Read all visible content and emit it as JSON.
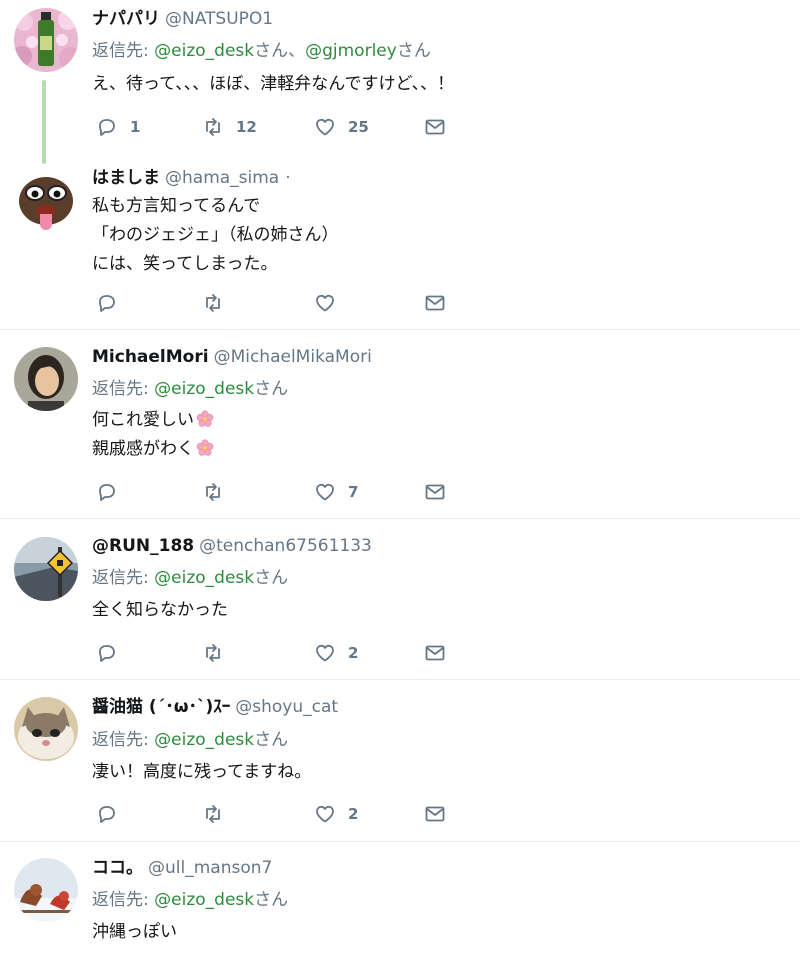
{
  "tweets": [
    {
      "name": "ナパパリ",
      "handle": "@NATSUPO1",
      "reply_prefix": "返信先: ",
      "mentions": [
        "@eizo_desk",
        "@gjmorley"
      ],
      "mention_suffix": "さん",
      "mention_sep": "、",
      "lines": [
        "え、待って、、、ほぼ、津軽弁なんですけど、、！"
      ],
      "replies": "1",
      "retweets": "12",
      "likes": "25",
      "avatar_icon": "green-bottle-on-flowers-avatar"
    },
    {
      "name": "はましま",
      "handle": "@hama_sima",
      "dot": "·",
      "lines": [
        "私も方言知ってるんで",
        "「わのジェジェ」（私の姉さん）",
        "には、笑ってしまった。"
      ],
      "replies": "",
      "retweets": "",
      "likes": "",
      "avatar_icon": "cartoon-face-avatar"
    },
    {
      "name": "MichaelMori",
      "handle": "@MichaelMikaMori",
      "reply_prefix": "返信先: ",
      "mentions": [
        "@eizo_desk"
      ],
      "mention_suffix": "さん",
      "lines": [
        "何これ愛しい",
        "親戚感がわく"
      ],
      "line_emoji": [
        "cherry-blossom",
        "cherry-blossom"
      ],
      "replies": "",
      "retweets": "",
      "likes": "7",
      "avatar_icon": "woman-portrait-avatar"
    },
    {
      "name": "@RUN_188",
      "handle": "@tenchan67561133",
      "reply_prefix": "返信先: ",
      "mentions": [
        "@eizo_desk"
      ],
      "mention_suffix": "さん",
      "lines": [
        "全く知らなかった"
      ],
      "replies": "",
      "retweets": "",
      "likes": "2",
      "avatar_icon": "road-sign-avatar"
    },
    {
      "name": "醤油猫 (´･ω･`)ｽｰ",
      "handle": "@shoyu_cat",
      "reply_prefix": "返信先: ",
      "mentions": [
        "@eizo_desk"
      ],
      "mention_suffix": "さん",
      "lines": [
        "凄い！高度に残ってますね。"
      ],
      "replies": "",
      "retweets": "",
      "likes": "2",
      "avatar_icon": "cat-avatar"
    },
    {
      "name": "ココ。",
      "handle": "@ull_manson7",
      "reply_prefix": "返信先: ",
      "mentions": [
        "@eizo_desk"
      ],
      "mention_suffix": "さん",
      "lines": [
        "沖縄っぽい"
      ],
      "avatar_icon": "birds-in-snow-avatar"
    }
  ],
  "colors": {
    "mention": "#2e8b3d",
    "muted": "#657786",
    "thread_line": "#b6dbb0",
    "separator": "#e6ecf0"
  },
  "icons": {
    "reply": "reply-icon",
    "retweet": "retweet-icon",
    "like": "heart-icon",
    "dm": "envelope-icon"
  }
}
